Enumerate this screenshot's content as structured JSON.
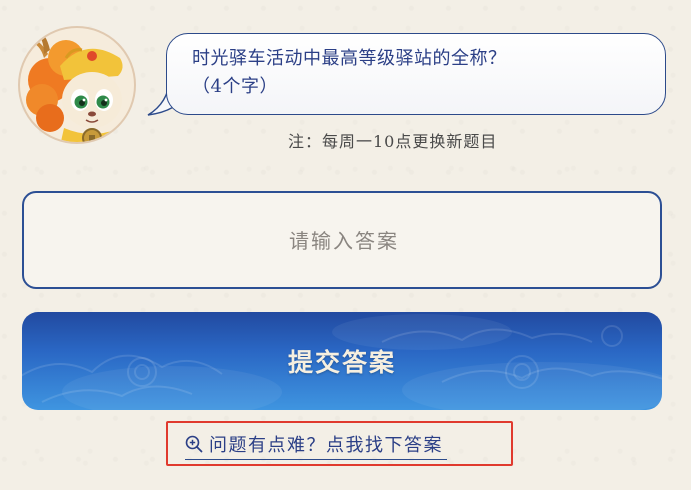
{
  "question": {
    "line1": "时光驿车活动中最高等级驿站的全称？",
    "line2": "（4个字）"
  },
  "note": "注：每周一10点更换新题目",
  "answer": {
    "placeholder": "请输入答案"
  },
  "submit": {
    "label": "提交答案"
  },
  "hint": {
    "label": "问题有点难？点我找下答案"
  },
  "colors": {
    "accent_blue": "#2c4a8a",
    "button_top": "#224aa0",
    "button_bottom": "#3f95e0",
    "highlight_red": "#e03a2e",
    "background": "#f3efe6"
  },
  "icons": {
    "avatar": "dragon-cub-mascot-avatar",
    "hint": "zoom-in-icon"
  }
}
